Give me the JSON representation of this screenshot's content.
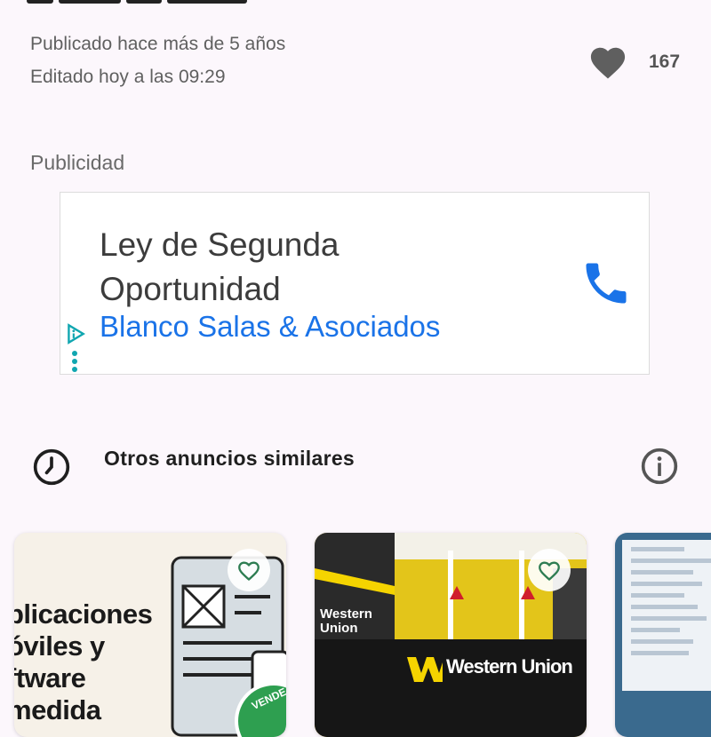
{
  "post": {
    "published": "Publicado hace más de 5 años",
    "edited": "Editado hoy a las 09:29",
    "likes": "167"
  },
  "ad": {
    "section_label": "Publicidad",
    "title_line1": "Ley de Segunda",
    "title_line2": "Oportunidad",
    "advertiser": "Blanco Salas & Asociados"
  },
  "similar": {
    "title": "Otros anuncios similares",
    "cards": [
      {
        "lines": [
          "plicaciones",
          "óviles y",
          "ftware",
          "medida"
        ],
        "badge": "VENDE"
      },
      {
        "logo_small": "Western Union",
        "logo_counter": "Western Union"
      },
      {}
    ]
  },
  "icons": {
    "like": "heart-filled-icon",
    "call": "phone-icon",
    "adchoices": "adchoices-icon",
    "more": "more-vert-icon",
    "clock": "clock-icon",
    "info": "info-icon",
    "favorite": "heart-outline-icon"
  },
  "colors": {
    "background": "#fcf7fc",
    "accent_link": "#1a73e8",
    "favorite_icon": "#2e7d52",
    "like_icon": "#5f5f5f"
  }
}
